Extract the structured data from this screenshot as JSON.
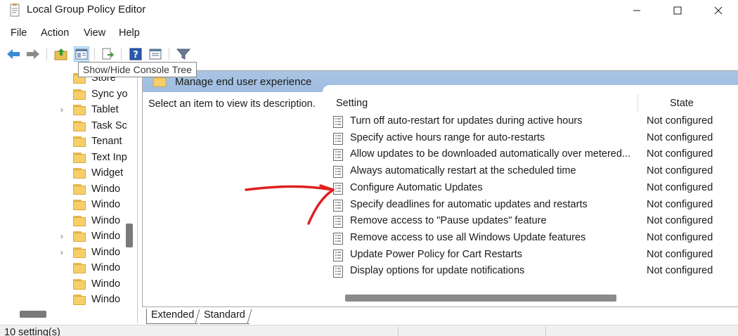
{
  "window": {
    "title": "Local Group Policy Editor",
    "minimize_glyph": "—",
    "maximize_glyph": "☐",
    "close_glyph": "✕"
  },
  "menu": [
    "File",
    "Action",
    "View",
    "Help"
  ],
  "toolbar": {
    "tooltip": "Show/Hide Console Tree",
    "buttons": [
      "back-icon",
      "forward-icon",
      "up-folder-icon",
      "show-hide-console-tree-icon",
      "export-list-icon",
      "help-icon",
      "extended-view-icon",
      "filter-icon"
    ]
  },
  "tree": {
    "items": [
      {
        "label": "Store",
        "expandable": false
      },
      {
        "label": "Sync yo",
        "expandable": false
      },
      {
        "label": "Tablet",
        "expandable": true
      },
      {
        "label": "Task Sc",
        "expandable": false
      },
      {
        "label": "Tenant",
        "expandable": false
      },
      {
        "label": "Text Inp",
        "expandable": false
      },
      {
        "label": "Widget",
        "expandable": false
      },
      {
        "label": "Windo",
        "expandable": false
      },
      {
        "label": "Windo",
        "expandable": false
      },
      {
        "label": "Windo",
        "expandable": false
      },
      {
        "label": "Windo",
        "expandable": true
      },
      {
        "label": "Windo",
        "expandable": true
      },
      {
        "label": "Windo",
        "expandable": false
      },
      {
        "label": "Windo",
        "expandable": false
      },
      {
        "label": "Windo",
        "expandable": false
      }
    ]
  },
  "right_pane": {
    "header_title": "Manage end user experience",
    "description": "Select an item to view its description.",
    "columns": {
      "setting": "Setting",
      "state": "State"
    },
    "rows": [
      {
        "setting": "Turn off auto-restart for updates during active hours",
        "state": "Not configured"
      },
      {
        "setting": "Specify active hours range for auto-restarts",
        "state": "Not configured"
      },
      {
        "setting": "Allow updates to be downloaded automatically over metered...",
        "state": "Not configured"
      },
      {
        "setting": "Always automatically restart at the scheduled time",
        "state": "Not configured"
      },
      {
        "setting": "Configure Automatic Updates",
        "state": "Not configured"
      },
      {
        "setting": "Specify deadlines for automatic updates and restarts",
        "state": "Not configured"
      },
      {
        "setting": "Remove access to \"Pause updates\" feature",
        "state": "Not configured"
      },
      {
        "setting": "Remove access to use all Windows Update features",
        "state": "Not configured"
      },
      {
        "setting": "Update Power Policy for Cart Restarts",
        "state": "Not configured"
      },
      {
        "setting": "Display options for update notifications",
        "state": "Not configured"
      }
    ]
  },
  "tabs": [
    {
      "label": "Extended",
      "active": true
    },
    {
      "label": "Standard",
      "active": false
    }
  ],
  "status": {
    "text": "10 setting(s)"
  },
  "colors": {
    "header_band": "#a9c4e3",
    "annotation_arrow": "#e02020",
    "pressed_button": "#cce4f7"
  }
}
